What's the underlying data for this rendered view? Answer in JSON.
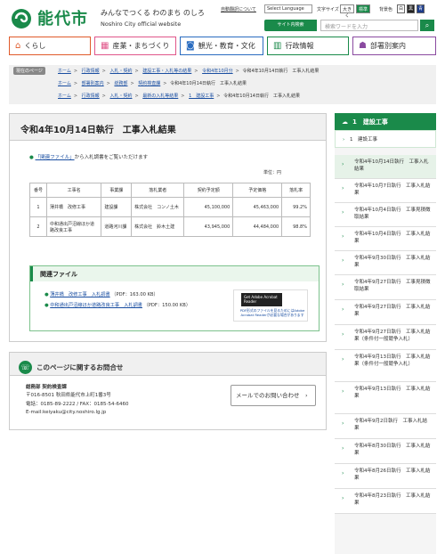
{
  "header": {
    "city_name": "能代市",
    "catch_copy": "みんなでつくる わのまち のしろ",
    "english_name": "Noshiro City official website",
    "auto_translate_link": "自動翻訳について",
    "language_select": "Select Language",
    "font_size_label": "文字サイズ",
    "font_size_large": "大きく",
    "font_size_standard": "標準",
    "bg_color_label": "背景色",
    "bg_white": "白",
    "bg_black": "黒",
    "bg_blue": "青",
    "search_label": "サイト内検索",
    "search_placeholder": "検索ワードを入力",
    "search_icon": "search-icon"
  },
  "gnav": [
    {
      "label": "くらし",
      "icon": "home-icon",
      "color": "#e05a2a"
    },
    {
      "label": "産業・まちづくり",
      "icon": "building-icon",
      "color": "#e0568a"
    },
    {
      "label": "観光・教育・文化",
      "icon": "camera-icon",
      "color": "#2a6cc0"
    },
    {
      "label": "行政情報",
      "icon": "government-icon",
      "color": "#1a8a4a"
    },
    {
      "label": "部署別案内",
      "icon": "people-icon",
      "color": "#8a4aa0"
    }
  ],
  "breadcrumb": {
    "tag": "現在のページ",
    "line1": [
      "ホーム",
      "行政情報",
      "入札・契約",
      "建設工事・入札等の結果",
      "令和4年10月分",
      "令和4年10月14日執行　工事入札結果"
    ],
    "line2": [
      "ホーム",
      "部署別案内",
      "総務部",
      "契約検査課",
      "令和4年10月14日執行　工事入札結果"
    ],
    "line3": [
      "ホーム",
      "行政情報",
      "入札・契約",
      "最新の入札等結果",
      "1　建設工事",
      "令和4年10月14日執行　工事入札結果"
    ]
  },
  "main": {
    "title": "令和4年10月14日執行　工事入札結果",
    "intro": "「関連ファイル」から入札調書をご覧いただけます",
    "intro_link": "「関連ファイル」",
    "intro_rest": "から入札調書をご覧いただけます",
    "unit": "単位：円",
    "table": {
      "headers": [
        "番号",
        "工事名",
        "事業課",
        "落札業者",
        "契約予定額",
        "予定価格",
        "落札率"
      ],
      "rows": [
        [
          "1",
          "薄井橋　改修工事",
          "建設課",
          "株式会社　コンノ土木",
          "45,100,000",
          "45,463,000",
          "99.2%"
        ],
        [
          "2",
          "中和通出戸沼線ほか道路改良工事",
          "道路河川課",
          "株式会社　鈴木土建",
          "43,945,000",
          "44,484,000",
          "98.8%"
        ]
      ]
    },
    "related": {
      "title": "関連ファイル",
      "files": [
        {
          "link": "薄井橋　改修工事　入札調書",
          "meta": "（PDF：163.00 KB）"
        },
        {
          "link": "中和通出戸沼線ほか道路改良工事　入札調書",
          "meta": "（PDF：150.00 KB）"
        }
      ],
      "reader_logo": "Get Adobe Acrobat Reader",
      "reader_text": "PDF形式のファイルを見るためにはAdobe Acrobat Readerが必要な場合があります"
    }
  },
  "contact": {
    "title": "このページに関するお問合せ",
    "dept": "総務部 契約検査課",
    "address": "〒016-8501 秋田県能代市上町1番3号",
    "phone": "電話：0185-89-2222 / FAX：0185-54-6460",
    "email": "E-mail:keiyaku@city.noshiro.lg.jp",
    "mail_button": "メールでのお問い合わせ　›"
  },
  "side": {
    "heading": "1　建設工事",
    "sub": "1　建設工事",
    "items": [
      "令和4年10月14日執行　工事入札結果",
      "令和4年10月7日執行　工事入札結果",
      "令和4年10月4日執行　工事見積徴取結果",
      "令和4年10月4日執行　工事入札結果",
      "令和4年9月30日執行　工事入札結果",
      "令和4年9月27日執行　工事見積徴取結果",
      "令和4年9月27日執行　工事入札結果",
      "令和4年9月27日執行　工事入札結果（条件付一般競争入札）",
      "令和4年9月13日執行　工事入札結果（条件付一般競争入札）",
      "令和4年9月13日執行　工事入札結果",
      "令和4年9月2日執行　工事入札結果",
      "令和4年8月30日執行　工事入札結果",
      "令和4年8月26日執行　工事入札結果",
      "令和4年8月23日執行　工事入札結果"
    ]
  }
}
